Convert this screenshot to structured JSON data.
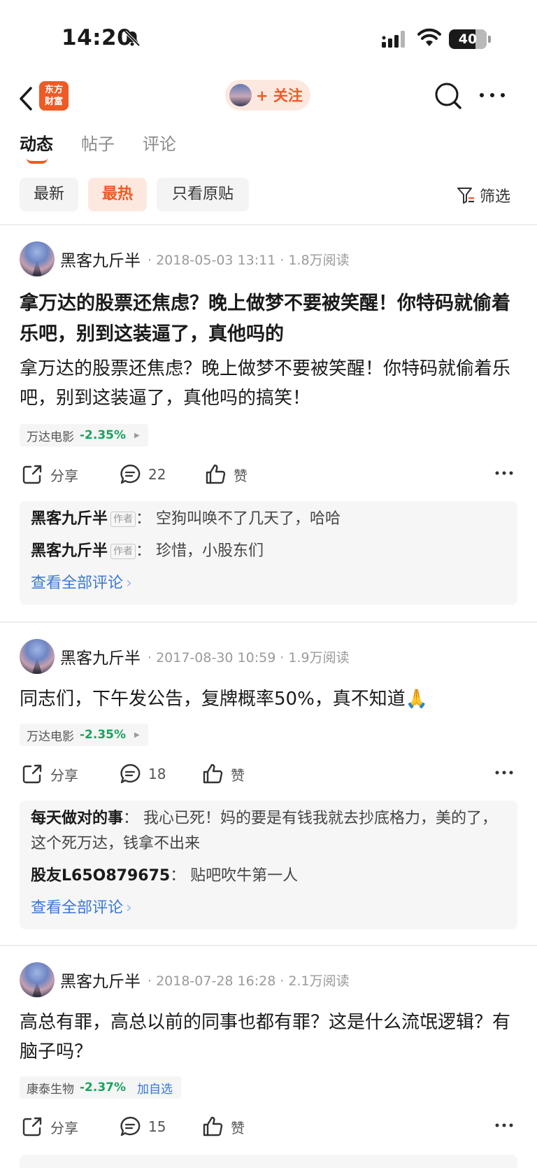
{
  "status_bar": {
    "time": "14:20",
    "battery": "40"
  },
  "nav": {
    "logo_line1": "东方",
    "logo_line2": "财富",
    "follow_label": "+ 关注"
  },
  "tabs": [
    {
      "label": "动态"
    },
    {
      "label": "帖子"
    },
    {
      "label": "评论"
    }
  ],
  "filters": {
    "latest": "最新",
    "hot": "最热",
    "original_only": "只看原贴",
    "filter": "筛选"
  },
  "posts": [
    {
      "author": "黑客九斤半",
      "meta": "· 2018-05-03 13:11 · 1.8万阅读",
      "title": "拿万达的股票还焦虑？晚上做梦不要被笑醒！你特码就偷着乐吧，别到这装逼了，真他吗的",
      "body": "拿万达的股票还焦虑？晚上做梦不要被笑醒！你特码就偷着乐吧，别到这装逼了，真他吗的搞笑！",
      "stock": {
        "name": "万达电影",
        "change": "-2.35%"
      },
      "actions": {
        "share": "分享",
        "comments": "22",
        "like": "赞"
      },
      "comments": [
        {
          "user": "黑客九斤半",
          "badge": "作者",
          "text": "：  空狗叫唤不了几天了，哈哈"
        },
        {
          "user": "黑客九斤半",
          "badge": "作者",
          "text": "：  珍惜，小股东们"
        }
      ],
      "view_all": "查看全部评论"
    },
    {
      "author": "黑客九斤半",
      "meta": "· 2017-08-30 10:59 · 1.9万阅读",
      "body": "同志们，下午发公告，复牌概率50%，真不知道🙏",
      "stock": {
        "name": "万达电影",
        "change": "-2.35%"
      },
      "actions": {
        "share": "分享",
        "comments": "18",
        "like": "赞"
      },
      "comments": [
        {
          "user": "每天做对的事",
          "text": "：  我心已死！妈的要是有钱我就去抄底格力，美的了，这个死万达，钱拿不出来"
        },
        {
          "user": "股友L65O879675",
          "text": "：  贴吧吹牛第一人"
        }
      ],
      "view_all": "查看全部评论"
    },
    {
      "author": "黑客九斤半",
      "meta": "· 2018-07-28 16:28 · 2.1万阅读",
      "body": "高总有罪，高总以前的同事也都有罪？这是什么流氓逻辑？有脑子吗？",
      "stock": {
        "name": "康泰生物",
        "change": "-2.37%",
        "add": "加自选"
      },
      "actions": {
        "share": "分享",
        "comments": "15",
        "like": "赞"
      }
    }
  ],
  "colors": {
    "accent": "#ee5a24",
    "down_green": "#1aa260",
    "link_blue": "#3a78d8"
  }
}
